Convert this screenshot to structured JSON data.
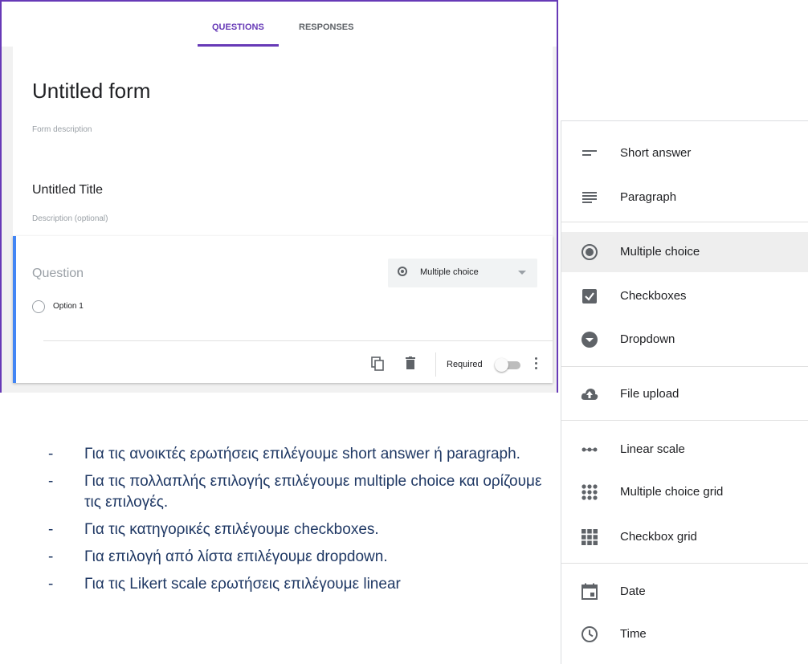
{
  "tabs": [
    {
      "label": "QUESTIONS",
      "active": true
    },
    {
      "label": "RESPONSES",
      "active": false
    }
  ],
  "form": {
    "title": "Untitled form",
    "description_placeholder": "Form description",
    "section_title": "Untitled Title",
    "section_description_placeholder": "Description (optional)"
  },
  "question": {
    "placeholder": "Question",
    "type": "Multiple choice",
    "options": [
      "Option 1"
    ],
    "required_label": "Required",
    "required": false
  },
  "menu": {
    "items": [
      {
        "label": "Short answer",
        "icon": "short-answer-icon"
      },
      {
        "label": "Paragraph",
        "icon": "paragraph-icon"
      },
      {
        "label": "Multiple choice",
        "icon": "radio-button-icon",
        "selected": true
      },
      {
        "label": "Checkboxes",
        "icon": "checkbox-icon"
      },
      {
        "label": "Dropdown",
        "icon": "dropdown-icon"
      },
      {
        "label": "File upload",
        "icon": "cloud-upload-icon"
      },
      {
        "label": "Linear scale",
        "icon": "linear-scale-icon"
      },
      {
        "label": "Multiple choice grid",
        "icon": "grid-dots-icon"
      },
      {
        "label": "Checkbox grid",
        "icon": "grid-squares-icon"
      },
      {
        "label": "Date",
        "icon": "calendar-icon"
      },
      {
        "label": "Time",
        "icon": "clock-icon"
      }
    ]
  },
  "notes": [
    "Για τις ανοικτές ερωτήσεις  επιλέγουμε short answer ή paragraph.",
    "Για τις πολλαπλής επιλογής επιλέγουμε multiple choice και ορίζουμε τις επιλογές.",
    "Για τις κατηγορικές επιλέγουμε checkboxes.",
    "Για επιλογή από λίστα επιλέγουμε dropdown.",
    "Για τις Likert scale ερωτήσεις επιλέγουμε linear"
  ],
  "colors": {
    "accent": "#673ab7",
    "active_question_border": "#4285f4",
    "note_text": "#1f3864"
  }
}
